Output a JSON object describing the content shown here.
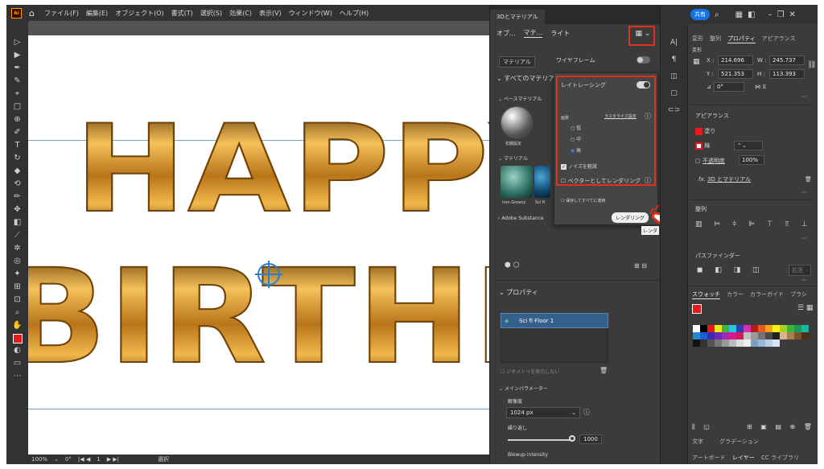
{
  "app": {
    "logo": "Ai"
  },
  "menu": [
    "ファイル(F)",
    "編集(E)",
    "オブジェクト(O)",
    "書式(T)",
    "選択(S)",
    "効果(C)",
    "表示(V)",
    "ウィンドウ(W)",
    "ヘルプ(H)"
  ],
  "artwork": {
    "line1": "HAPPY",
    "line2": "BIRTHDAY"
  },
  "status": {
    "zoom": "100%",
    "rotation": "0°",
    "page": "1",
    "tool": "選択"
  },
  "panel3d": {
    "title": "3Dとマテリアル",
    "tabs": [
      "オブ...",
      "マテ...",
      "ライト"
    ],
    "material_label": "マテリアル",
    "wireframe": "ワイヤフレーム",
    "all_materials": "すべてのマテリアル",
    "base_material": "ベースマテリアル",
    "default_label": "初期設定",
    "materials_label": "マテリアル",
    "mat1": "Iron Greeny",
    "mat2": "Sci fi",
    "adobe_substance": "Adobe Substance",
    "properties": "プロパティ",
    "selected_item": "Sci fi Floor 1",
    "show_geometry": "ジオメトリを表示しない",
    "main_params": "メインパラメーター",
    "resolution_label": "解像度",
    "resolution_value": "1024 px",
    "repeat_label": "繰り返し",
    "repeat_value": "1000",
    "blowup": "Blowup intensity"
  },
  "render_popover": {
    "raytracing": "レイトレーシング",
    "quality": "画質",
    "raster_settings": "ラスタライズ設定",
    "low": "低",
    "mid": "中",
    "high": "高",
    "noise": "ノイズを軽減",
    "vector": "ベクターとしてレンダリング",
    "save_apply": "保存してすべてに適用",
    "tooltip": "レンダリング",
    "tooltip2": "レンダ"
  },
  "right": {
    "share": "共有",
    "tabs": [
      "変形",
      "整列",
      "プロパティ",
      "アピアランス"
    ],
    "transform": "変形",
    "x_label": "X :",
    "x": "214.696",
    "w_label": "W :",
    "w": "245.737",
    "y_label": "Y :",
    "y": "521.353",
    "h_label": "H :",
    "h": "113.393",
    "angle": "0°",
    "appearance": "アピアランス",
    "fill": "塗り",
    "stroke": "線",
    "opacity_label": "不透明度",
    "opacity": "100%",
    "fx": "3D とマテリアル",
    "align": "整列",
    "pathfinder": "パスファインダー",
    "expand": "拡張",
    "swatch_tabs": [
      "スウォッチ",
      "カラー",
      "カラーガイド",
      "ブラシ"
    ],
    "bottom_tabs1": [
      "文字",
      "グラデーション"
    ],
    "bottom_tabs2": [
      "アートボード",
      "レイヤー",
      "CC ライブラリ"
    ]
  },
  "colors": {
    "accent": "#e1301b",
    "blue": "#1473e6",
    "gold": "#c88a1f"
  }
}
